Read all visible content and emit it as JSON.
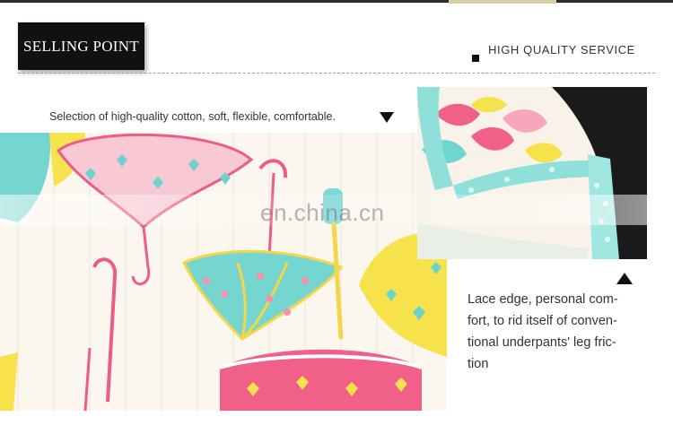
{
  "header": {
    "badge_label": "SELLING POINT",
    "service_label": "HIGH QUALITY SERVICE"
  },
  "features": {
    "fabric_caption": "Selection of high-quality cotton, soft, flexible, comfortable.",
    "lace_caption_lines": [
      "Lace edge, personal com-",
      "fort, to rid itself of conven-",
      "tional underpants' leg fric-",
      "tion"
    ]
  },
  "watermark": "en.china.cn",
  "icons": {
    "down_marker": "triangle-down-icon",
    "up_marker": "triangle-up-icon",
    "bullet": "square-bullet-icon"
  },
  "colors": {
    "badge_bg": "#111111",
    "text": "#333333",
    "pink": "#f0608a",
    "cyan": "#6fd6cf",
    "yellow": "#f6e24a"
  }
}
